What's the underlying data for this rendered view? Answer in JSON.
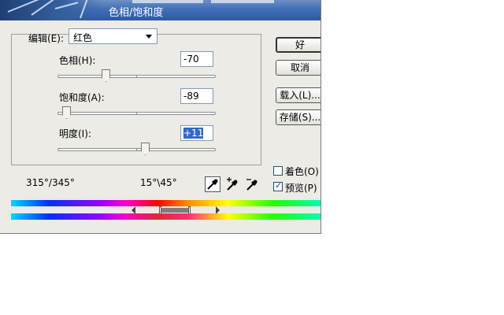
{
  "window": {
    "title": "色相/饱和度"
  },
  "edit": {
    "label": "编辑(E):",
    "value": "红色"
  },
  "hue": {
    "label": "色相(H):",
    "value": "-70",
    "level": 0.306
  },
  "saturation": {
    "label": "饱和度(A):",
    "value": "-89",
    "level": 0.055
  },
  "lightness": {
    "label": "明度(I):",
    "value": "+11",
    "level": 0.555
  },
  "buttons": {
    "ok": "好",
    "cancel": "取消",
    "load": "载入(L)...",
    "save": "存储(S)..."
  },
  "options": {
    "colorize": {
      "label": "着色(O)",
      "checked": false
    },
    "preview": {
      "label": "预览(P)",
      "checked": true
    }
  },
  "range": {
    "left": "315°/345°",
    "right": "15°\\45°"
  },
  "icons": {
    "eyedropper": "eyedropper-icon",
    "eyedropper_add": "eyedropper-plus-icon",
    "eyedropper_subtract": "eyedropper-minus-icon"
  }
}
